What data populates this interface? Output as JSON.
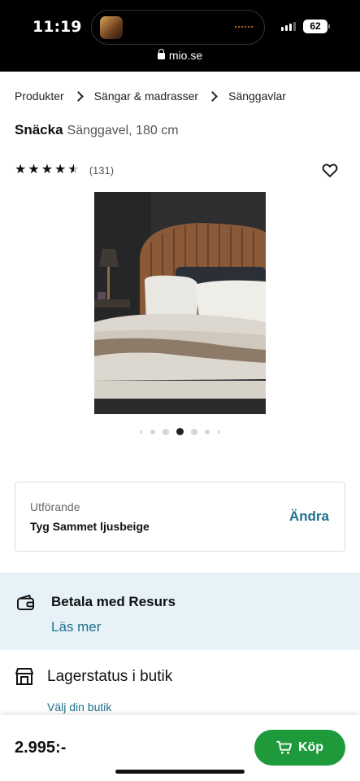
{
  "status": {
    "time": "11:19",
    "battery": "62",
    "url": "mio.se"
  },
  "breadcrumb": [
    "Produkter",
    "Sängar & madrasser",
    "Sänggavlar"
  ],
  "product": {
    "name": "Snäcka",
    "subtitle": "Sänggavel, 180 cm",
    "rating": 4.5,
    "rating_count": "(131)",
    "image_index": 4,
    "image_count": 7
  },
  "variant": {
    "label": "Utförande",
    "value": "Tyg Sammet ljusbeige",
    "change": "Ändra"
  },
  "payment": {
    "title": "Betala med Resurs",
    "link": "Läs mer"
  },
  "store": {
    "title": "Lagerstatus i butik",
    "link": "Välj din butik"
  },
  "checkout": {
    "price": "2.995:-",
    "buy_label": "Köp"
  },
  "colors": {
    "accent_link": "#1f6e8c",
    "buy_green": "#1f9a3b",
    "banner_bg": "#e6f2f8"
  }
}
